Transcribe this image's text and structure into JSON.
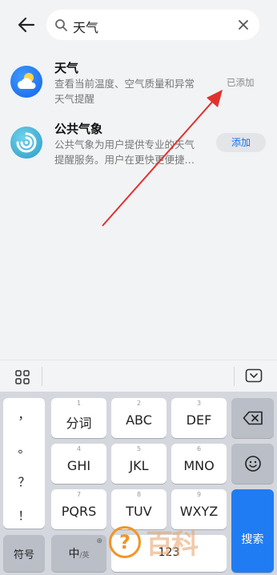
{
  "search": {
    "query": "天气"
  },
  "results": [
    {
      "title": "天气",
      "desc_line1": "查看当前温度、空气质量和异常",
      "desc_line2": "天气提醒",
      "status": "已添加"
    },
    {
      "title": "公共气象",
      "desc_line1": "公共气象为用户提供专业的天气",
      "desc_line2": "提醒服务。用户在更快更便捷…",
      "action": "添加"
    }
  ],
  "keyboard": {
    "punctuation": [
      "，",
      "。",
      "？",
      "！"
    ],
    "row1": [
      {
        "num": "1",
        "label": "分词"
      },
      {
        "num": "2",
        "label": "ABC"
      },
      {
        "num": "3",
        "label": "DEF"
      }
    ],
    "row2": [
      {
        "num": "4",
        "label": "GHI"
      },
      {
        "num": "5",
        "label": "JKL"
      },
      {
        "num": "6",
        "label": "MNO"
      }
    ],
    "row3": [
      {
        "num": "7",
        "label": "PQRS"
      },
      {
        "num": "8",
        "label": "TUV"
      },
      {
        "num": "9",
        "label": "WXYZ"
      }
    ],
    "symbol_key": "符号",
    "lang_key": "中",
    "lang_sub": "/英",
    "space_num": "123",
    "search_key": "搜索"
  },
  "watermark": {
    "text": "百科"
  },
  "colors": {
    "accent": "#1f7cf2",
    "arrow": "#e0322d",
    "watermark": "#f29524"
  }
}
